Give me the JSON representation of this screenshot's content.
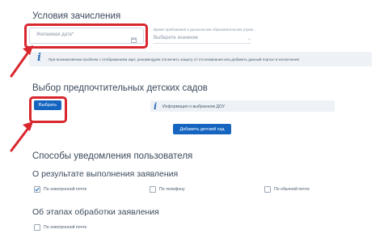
{
  "enrollment": {
    "title": "Условия зачисления",
    "date_placeholder": "Желаемая дата*",
    "select_label": "Время пребывания в дошкольном образовательном учреж...",
    "select_value": "Выберите значение"
  },
  "info_notice": "При возникновении проблем с отображением карт, рекомендуем отключить защиту от отслеживания или добавить данный портал в исключения",
  "kindergarten": {
    "title": "Выбор предпочтительных детских садов",
    "select_button": "Выбрать",
    "info_label": "Информация о выбранном ДОУ",
    "add_button": "Добавить детский сад"
  },
  "notifications": {
    "title": "Способы уведомления пользователя",
    "result_title": "О результате выполнения заявления",
    "options": [
      {
        "label": "По электронной почте",
        "checked": true
      },
      {
        "label": "По телефону",
        "checked": false
      },
      {
        "label": "По обычной почте",
        "checked": false
      }
    ],
    "stages_title": "Об этапах обработки заявления",
    "stages_options": [
      {
        "label": "По электронной почте",
        "checked": false
      }
    ]
  },
  "colors": {
    "primary": "#1565c0",
    "annotation": "#d9272e"
  }
}
